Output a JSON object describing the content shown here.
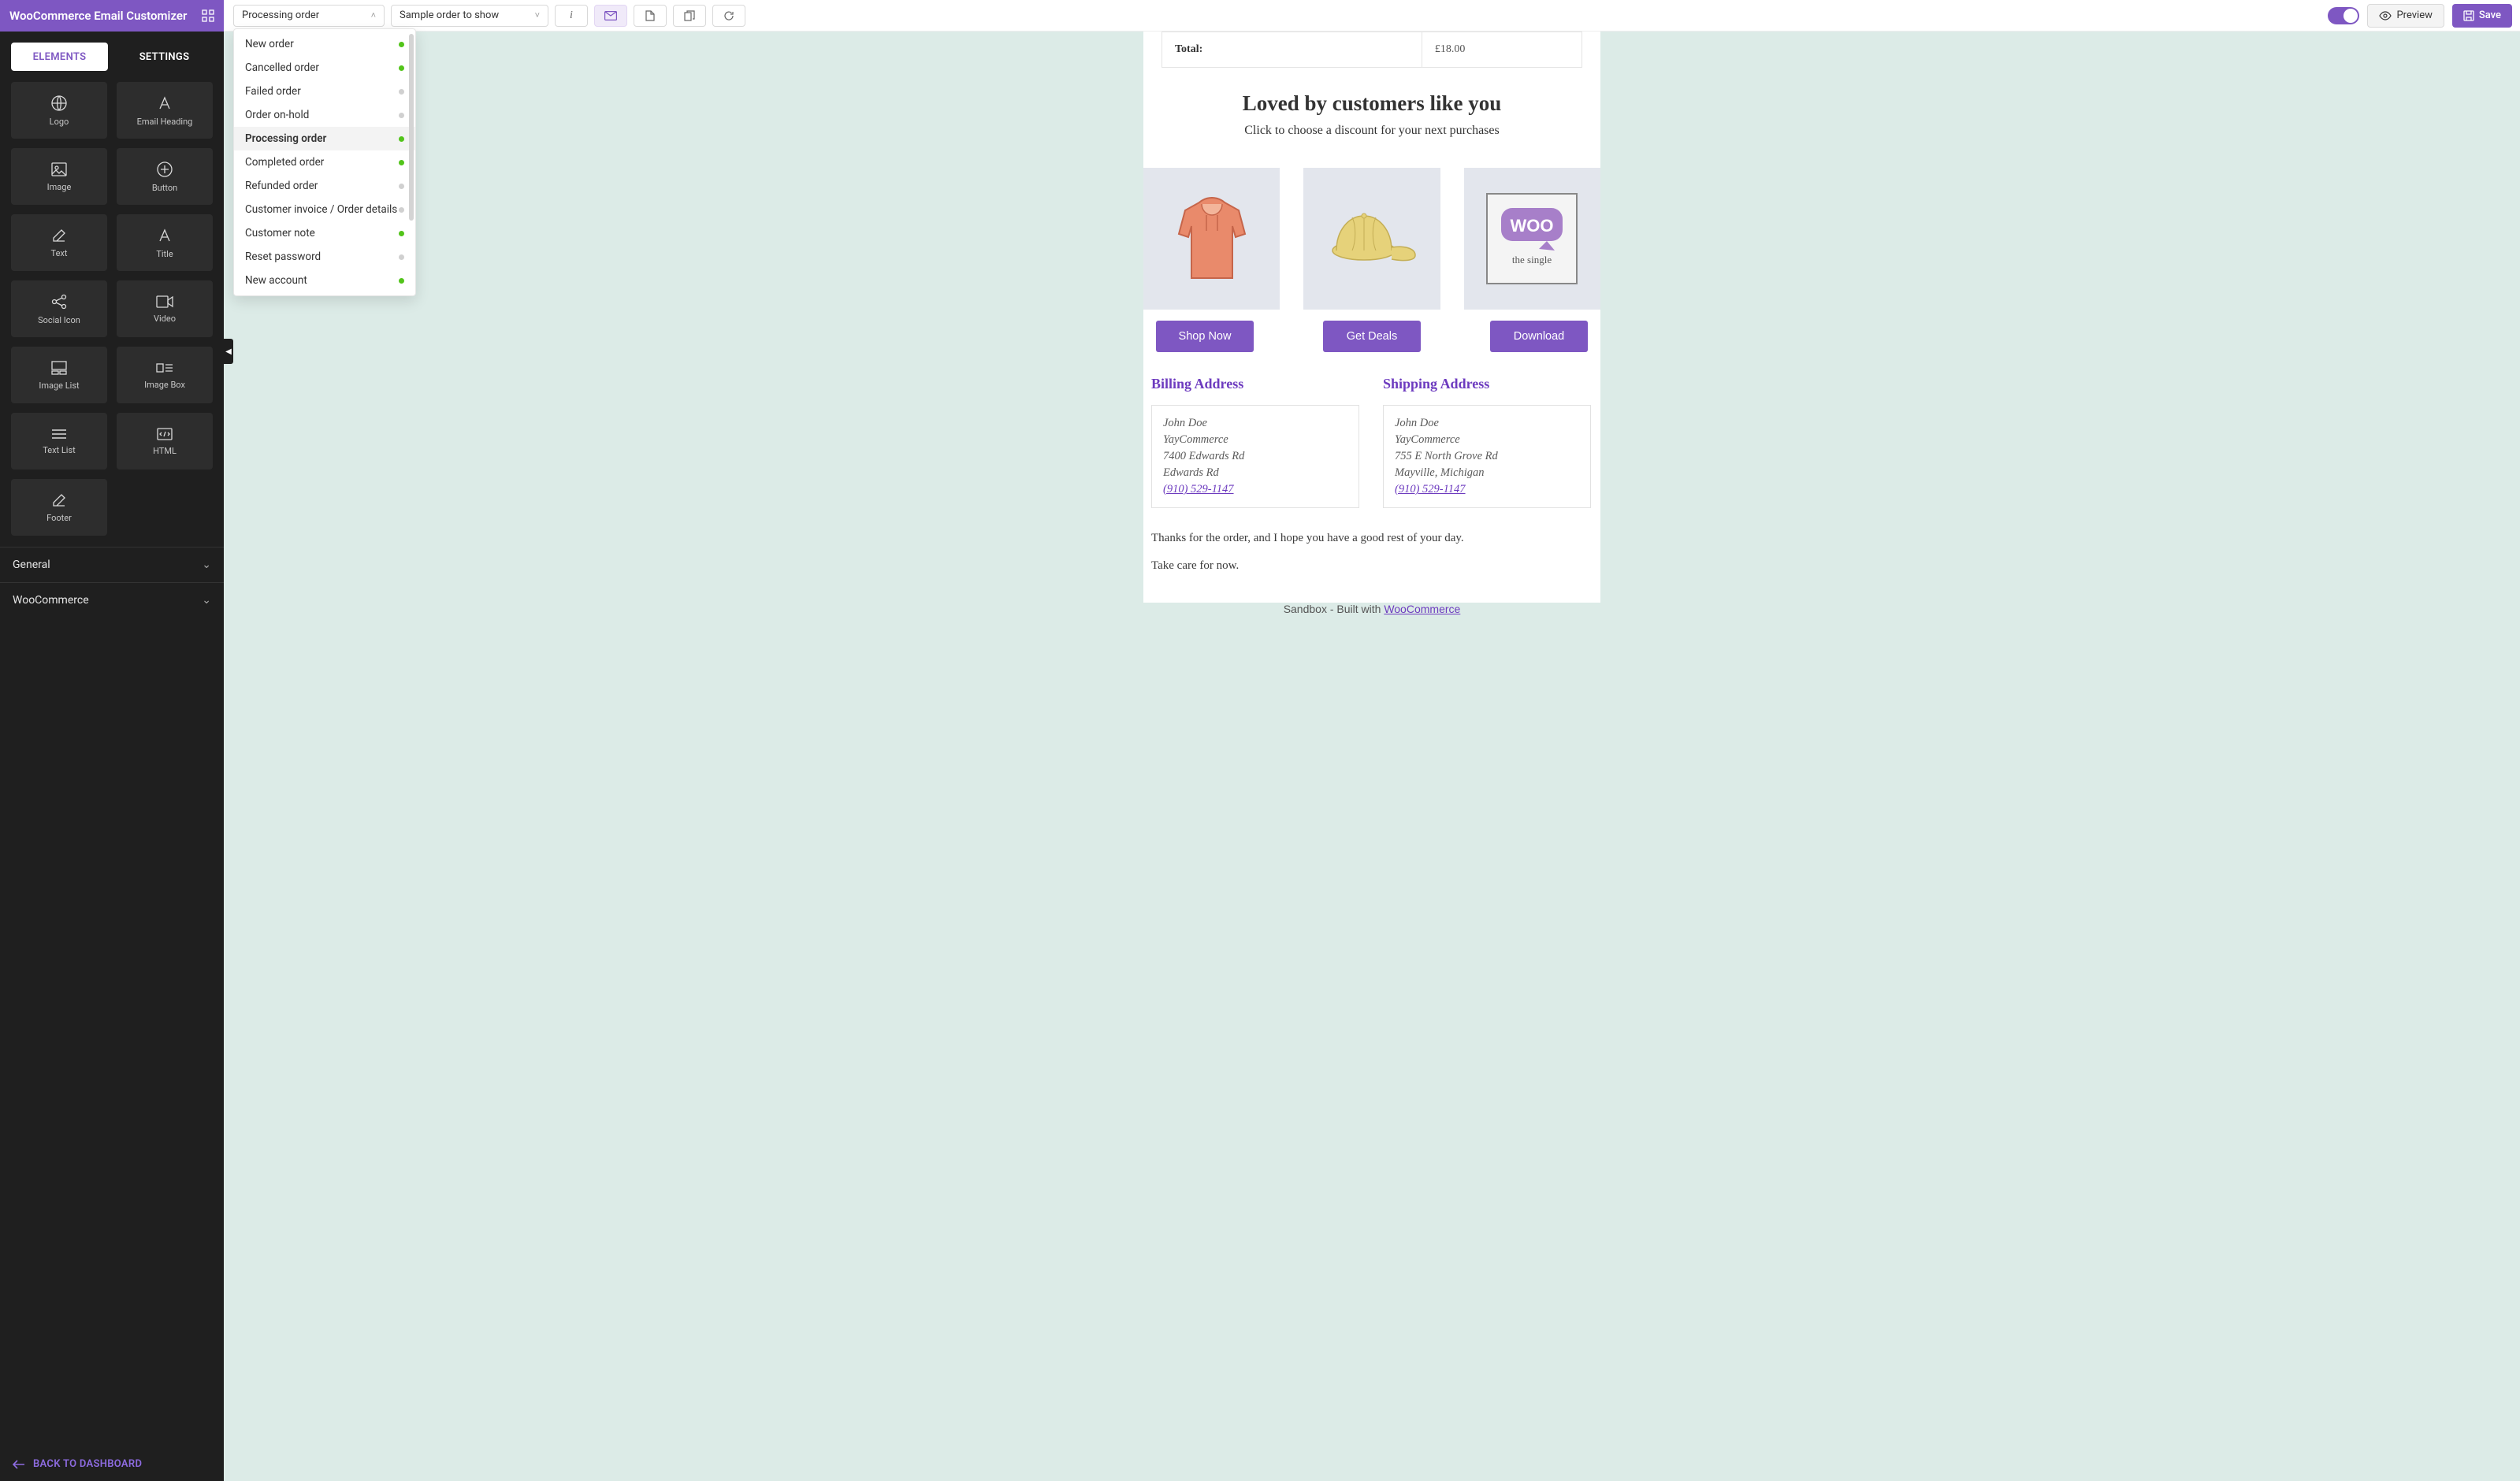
{
  "app_title": "WooCommerce Email Customizer",
  "sidebar": {
    "tabs": {
      "elements": "ELEMENTS",
      "settings": "SETTINGS"
    },
    "elements": [
      {
        "label": "Logo",
        "icon": "globe-icon"
      },
      {
        "label": "Email Heading",
        "icon": "text-style-icon"
      },
      {
        "label": "Image",
        "icon": "image-icon"
      },
      {
        "label": "Button",
        "icon": "plus-circle-icon"
      },
      {
        "label": "Text",
        "icon": "edit-icon"
      },
      {
        "label": "Title",
        "icon": "text-style-icon"
      },
      {
        "label": "Social Icon",
        "icon": "share-icon"
      },
      {
        "label": "Video",
        "icon": "video-icon"
      },
      {
        "label": "Image List",
        "icon": "image-list-icon"
      },
      {
        "label": "Image Box",
        "icon": "image-box-icon"
      },
      {
        "label": "Text List",
        "icon": "lines-icon"
      },
      {
        "label": "HTML",
        "icon": "code-icon"
      },
      {
        "label": "Footer",
        "icon": "edit-icon"
      }
    ],
    "groups": {
      "general": "General",
      "woocommerce": "WooCommerce"
    },
    "back": "BACK TO DASHBOARD"
  },
  "toolbar": {
    "order_select": "Processing order",
    "sample_select": "Sample order to show",
    "preview": "Preview",
    "save": "Save"
  },
  "dropdown": {
    "items": [
      {
        "label": "New order",
        "status": "green"
      },
      {
        "label": "Cancelled order",
        "status": "green"
      },
      {
        "label": "Failed order",
        "status": "gray"
      },
      {
        "label": "Order on-hold",
        "status": "gray"
      },
      {
        "label": "Processing order",
        "status": "green",
        "selected": true
      },
      {
        "label": "Completed order",
        "status": "green"
      },
      {
        "label": "Refunded order",
        "status": "gray"
      },
      {
        "label": "Customer invoice / Order details",
        "status": "gray"
      },
      {
        "label": "Customer note",
        "status": "green"
      },
      {
        "label": "Reset password",
        "status": "gray"
      },
      {
        "label": "New account",
        "status": "green"
      }
    ]
  },
  "email": {
    "total_label": "Total:",
    "total_value": "£18.00",
    "headline": "Loved by customers like you",
    "subhead": "Click to choose a discount for your next purchases",
    "cta": [
      "Shop Now",
      "Get Deals",
      "Download"
    ],
    "billing_title": "Billing Address",
    "shipping_title": "Shipping Address",
    "billing": {
      "name": "John Doe",
      "company": "YayCommerce",
      "line1": "7400 Edwards Rd",
      "line2": "Edwards Rd",
      "phone": "(910) 529-1147"
    },
    "shipping": {
      "name": "John Doe",
      "company": "YayCommerce",
      "line1": "755 E North Grove Rd",
      "line2": "Mayville, Michigan",
      "phone": "(910) 529-1147"
    },
    "thanks": "Thanks for the order, and I hope you have a good rest of your day.",
    "care": "Take care for now.",
    "footer_prefix": "Sandbox - Built with ",
    "footer_link": "WooCommerce"
  }
}
